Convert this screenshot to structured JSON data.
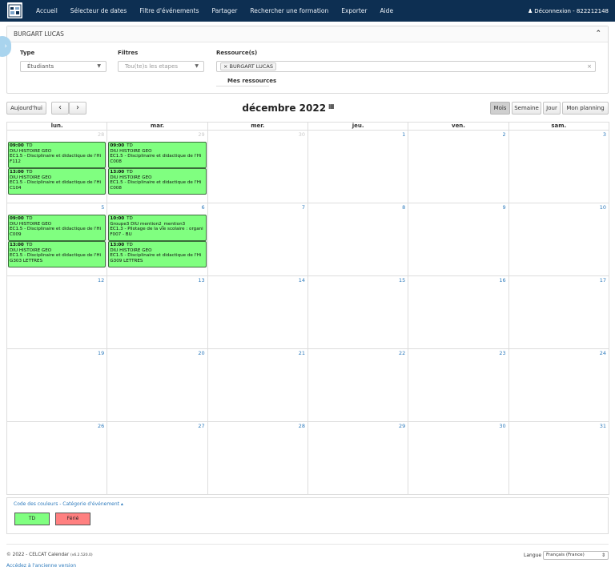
{
  "nav": {
    "items": [
      "Accueil",
      "Sélecteur de dates",
      "Filtre d'événements",
      "Partager",
      "Rechercher une formation",
      "Exporter",
      "Aide"
    ],
    "logout": "Déconnexion - 822212148"
  },
  "panel": {
    "title": "BURGART LUCAS",
    "type_label": "Type",
    "type_value": "Étudiants",
    "filters_label": "Filtres",
    "filters_placeholder": "Tou(te)s les etapes",
    "resources_label": "Ressource(s)",
    "resource_tag": "× BURGART LUCAS",
    "clear": "×",
    "my_resources": "Mes ressources"
  },
  "toolbar": {
    "today": "Aujourd'hui",
    "prev": "‹",
    "next": "›",
    "title": "décembre 2022",
    "views": [
      "Mois",
      "Semaine",
      "Jour",
      "Mon planning"
    ]
  },
  "calendar": {
    "weekdays": [
      "lun.",
      "mar.",
      "mer.",
      "jeu.",
      "ven.",
      "sam."
    ],
    "weeks": [
      [
        {
          "day": "28",
          "other": true,
          "events": [
            {
              "time": "09:00",
              "type": "TD",
              "l1": "DIU HISTOIRE GEO",
              "l2": "EC1.5 - Disciplinaire et didactique de l'Hi",
              "l3": "F112"
            },
            {
              "time": "13:00",
              "type": "TD",
              "l1": "DIU HISTOIRE GEO",
              "l2": "EC1.5 - Disciplinaire et didactique de l'Hi",
              "l3": "C104"
            }
          ]
        },
        {
          "day": "29",
          "other": true,
          "events": [
            {
              "time": "09:00",
              "type": "TD",
              "l1": "DIU HISTOIRE GEO",
              "l2": "EC1.5 - Disciplinaire et didactique de l'Hi",
              "l3": "C008"
            },
            {
              "time": "13:00",
              "type": "TD",
              "l1": "DIU HISTOIRE GEO",
              "l2": "EC1.5 - Disciplinaire et didactique de l'Hi",
              "l3": "C008"
            }
          ]
        },
        {
          "day": "30",
          "other": true,
          "events": []
        },
        {
          "day": "1",
          "other": false,
          "events": []
        },
        {
          "day": "2",
          "other": false,
          "events": []
        },
        {
          "day": "3",
          "other": false,
          "events": []
        }
      ],
      [
        {
          "day": "5",
          "other": false,
          "events": [
            {
              "time": "09:00",
              "type": "TD",
              "l1": "DIU HISTOIRE GEO",
              "l2": "EC1.5 - Disciplinaire et didactique de l'Hi",
              "l3": "C009"
            },
            {
              "time": "13:00",
              "type": "TD",
              "l1": "DIU HISTOIRE GEO",
              "l2": "EC1.5 - Disciplinaire et didactique de l'Hi",
              "l3": "G303 LETTRES"
            }
          ]
        },
        {
          "day": "6",
          "other": false,
          "events": [
            {
              "time": "10:00",
              "type": "TD",
              "l1": "Groupe3 DIU mention2_mention3",
              "l2": "EC1.3 - Pilotage de la vie scolaire : organi",
              "l3": "F007 - BU"
            },
            {
              "time": "13:00",
              "type": "TD",
              "l1": "DIU HISTOIRE GEO",
              "l2": "EC1.5 - Disciplinaire et didactique de l'Hi",
              "l3": "G309 LETTRES"
            }
          ]
        },
        {
          "day": "7",
          "other": false,
          "events": []
        },
        {
          "day": "8",
          "other": false,
          "events": []
        },
        {
          "day": "9",
          "other": false,
          "events": []
        },
        {
          "day": "10",
          "other": false,
          "events": []
        }
      ],
      [
        {
          "day": "12",
          "other": false,
          "events": []
        },
        {
          "day": "13",
          "other": false,
          "events": []
        },
        {
          "day": "14",
          "other": false,
          "events": []
        },
        {
          "day": "15",
          "other": false,
          "events": []
        },
        {
          "day": "16",
          "other": false,
          "events": []
        },
        {
          "day": "17",
          "other": false,
          "events": []
        }
      ],
      [
        {
          "day": "19",
          "other": false,
          "events": []
        },
        {
          "day": "20",
          "other": false,
          "events": []
        },
        {
          "day": "21",
          "other": false,
          "events": []
        },
        {
          "day": "22",
          "other": false,
          "events": []
        },
        {
          "day": "23",
          "other": false,
          "events": []
        },
        {
          "day": "24",
          "other": false,
          "events": []
        }
      ],
      [
        {
          "day": "26",
          "other": false,
          "events": []
        },
        {
          "day": "27",
          "other": false,
          "events": []
        },
        {
          "day": "28",
          "other": false,
          "events": []
        },
        {
          "day": "29",
          "other": false,
          "events": []
        },
        {
          "day": "30",
          "other": false,
          "events": []
        },
        {
          "day": "31",
          "other": false,
          "events": []
        }
      ]
    ]
  },
  "legend": {
    "title": "Code des couleurs - Catégorie d'événement ▴",
    "items": [
      {
        "label": "TD",
        "color": "#80ff80"
      },
      {
        "label": "Férié",
        "color": "#ff8080"
      }
    ]
  },
  "footer": {
    "copyright": "© 2022 - CELCAT Calendar",
    "version": "(v6.2.520.0)",
    "old_version_link": "Accédez à l'ancienne version",
    "language_label": "Langue",
    "language_value": "Français (France)"
  }
}
